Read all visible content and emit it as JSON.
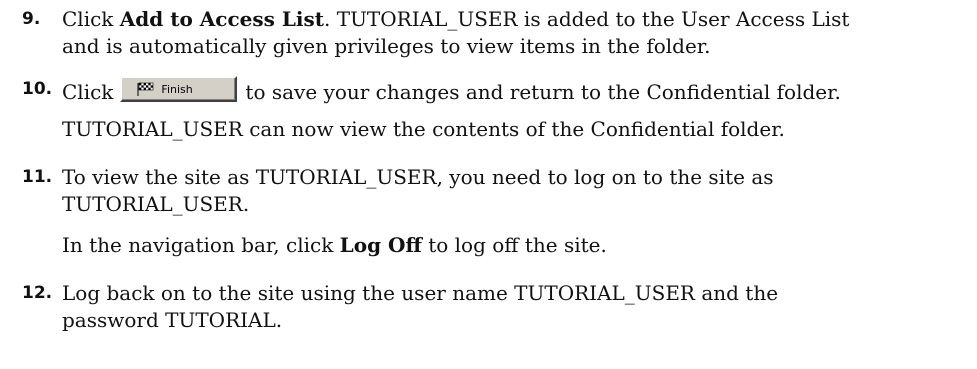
{
  "steps": [
    {
      "number": "9.",
      "line1_pre": "Click ",
      "line1_bold": "Add to Access List",
      "line1_post": ". TUTORIAL_USER is added to the User Access List",
      "line2": "and is automatically given privileges to view items in the folder."
    },
    {
      "number": "10.",
      "pre": "Click",
      "button_label": "Finish",
      "button_icon": "checkered-flag-icon",
      "post": "to save your changes and return to the Confidential folder.",
      "note": "TUTORIAL_USER can now view the contents of the Confidential folder."
    },
    {
      "number": "11.",
      "line1": "To view the site as TUTORIAL_USER, you need to log on to the site as",
      "line2": "TUTORIAL_USER.",
      "note_pre": "In the navigation bar, click ",
      "note_bold": "Log Off",
      "note_post": " to log off the site."
    },
    {
      "number": "12.",
      "line1": "Log back on to the site using the user name TUTORIAL_USER and the",
      "line2": "password TUTORIAL."
    }
  ]
}
